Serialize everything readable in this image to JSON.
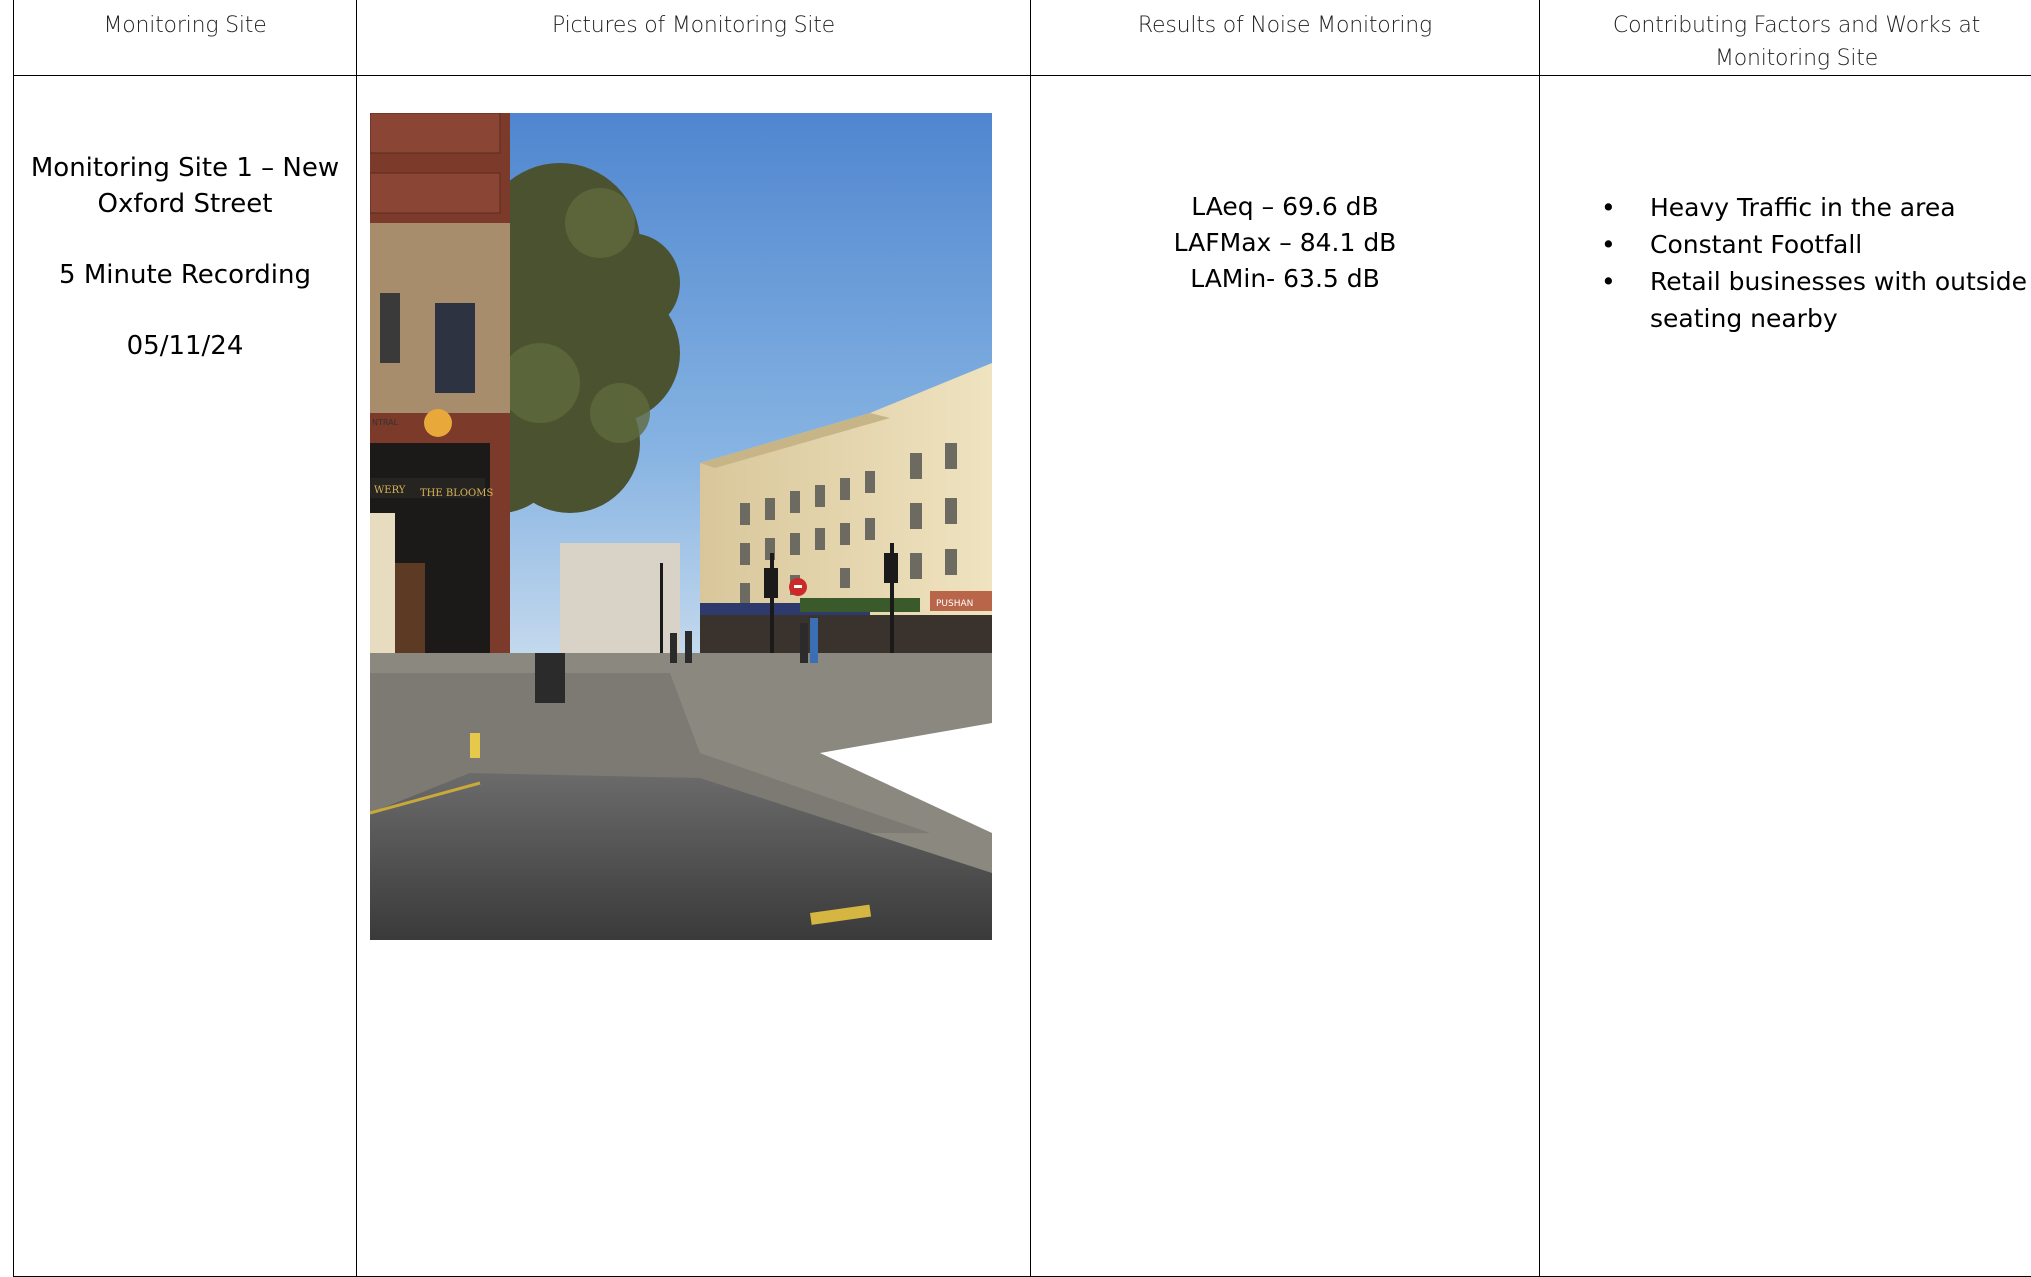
{
  "table": {
    "headers": [
      "Monitoring Site",
      "Pictures of Monitoring Site",
      "Results of Noise Monitoring",
      "Contributing Factors and Works at Monitoring Site"
    ],
    "site": {
      "name": "Monitoring Site 1 – New Oxford Street",
      "recording": "5 Minute Recording",
      "date": "05/11/24"
    },
    "photo": {
      "subject": "street-corner-photo",
      "sign_text_1": "WERY",
      "sign_text_2": "THE BLOOMS",
      "sign_text_3": "NTRAL",
      "shop_sign": "PUSHAN"
    },
    "results": [
      "LAeq – 69.6 dB",
      "LAFMax – 84.1 dB",
      "LAMin- 63.5 dB"
    ],
    "factors": [
      "Heavy Traffic in the area",
      "Constant Footfall",
      "Retail businesses with outside seating nearby"
    ],
    "bullet_symbol": "•"
  }
}
